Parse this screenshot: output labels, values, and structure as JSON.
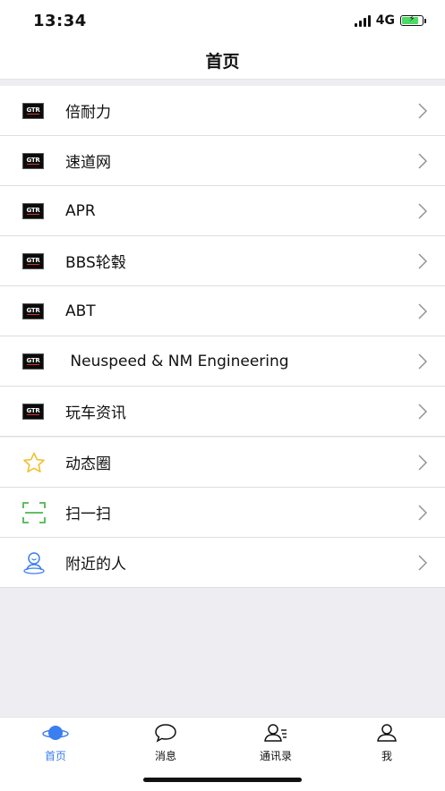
{
  "status": {
    "time": "13:34",
    "network": "4G"
  },
  "header": {
    "title": "首页"
  },
  "brands": [
    {
      "label": "倍耐力",
      "logo": "GTR"
    },
    {
      "label": "速道网",
      "logo": "GTR"
    },
    {
      "label": "APR",
      "logo": "GTR"
    },
    {
      "label": "BBS轮毂",
      "logo": "GTR"
    },
    {
      "label": "ABT",
      "logo": "GTR"
    },
    {
      "label": " Neuspeed & NM Engineering",
      "logo": "GTR"
    },
    {
      "label": "玩车资讯",
      "logo": "GTR"
    }
  ],
  "features": [
    {
      "label": "动态圈",
      "icon": "star-icon"
    },
    {
      "label": "扫一扫",
      "icon": "scan-icon"
    },
    {
      "label": "附近的人",
      "icon": "nearby-person-icon"
    }
  ],
  "tabs": [
    {
      "label": "首页",
      "icon": "planet-icon",
      "active": true
    },
    {
      "label": "消息",
      "icon": "chat-bubble-icon",
      "active": false
    },
    {
      "label": "通讯录",
      "icon": "contacts-icon",
      "active": false
    },
    {
      "label": "我",
      "icon": "person-icon",
      "active": false
    }
  ],
  "colors": {
    "accent": "#3c7ef0",
    "star": "#f0c030",
    "scan": "#4cb84c",
    "nearby": "#3c7ef0",
    "battery": "#4cd964"
  }
}
